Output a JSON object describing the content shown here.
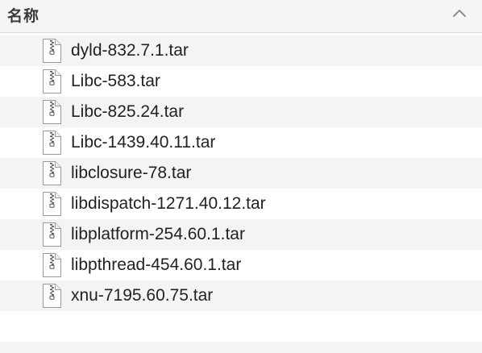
{
  "header": {
    "column_title": "名称",
    "sort_icon": "chevron-up-icon"
  },
  "files": [
    {
      "name": "dyld-832.7.1.tar",
      "icon": "zip-archive-icon"
    },
    {
      "name": "Libc-583.tar",
      "icon": "zip-archive-icon"
    },
    {
      "name": "Libc-825.24.tar",
      "icon": "zip-archive-icon"
    },
    {
      "name": "Libc-1439.40.11.tar",
      "icon": "zip-archive-icon"
    },
    {
      "name": "libclosure-78.tar",
      "icon": "zip-archive-icon"
    },
    {
      "name": "libdispatch-1271.40.12.tar",
      "icon": "zip-archive-icon"
    },
    {
      "name": "libplatform-254.60.1.tar",
      "icon": "zip-archive-icon"
    },
    {
      "name": "libpthread-454.60.1.tar",
      "icon": "zip-archive-icon"
    },
    {
      "name": "xnu-7195.60.75.tar",
      "icon": "zip-archive-icon"
    }
  ]
}
